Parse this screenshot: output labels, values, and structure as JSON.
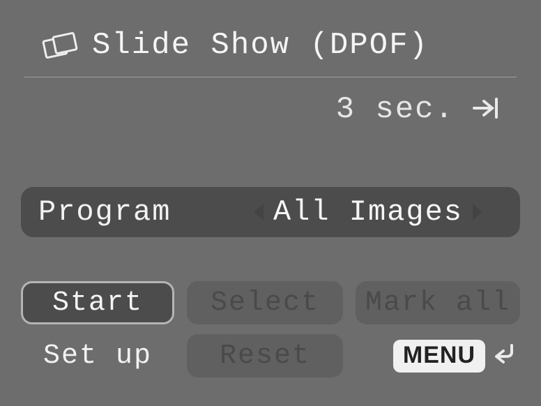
{
  "title": "Slide Show (DPOF)",
  "interval": "3 sec.",
  "selector": {
    "label": "Program",
    "value": "All Images"
  },
  "buttons": {
    "start": "Start",
    "select": "Select",
    "mark_all": "Mark all",
    "setup": "Set up",
    "reset": "Reset"
  },
  "menu_label": "MENU"
}
